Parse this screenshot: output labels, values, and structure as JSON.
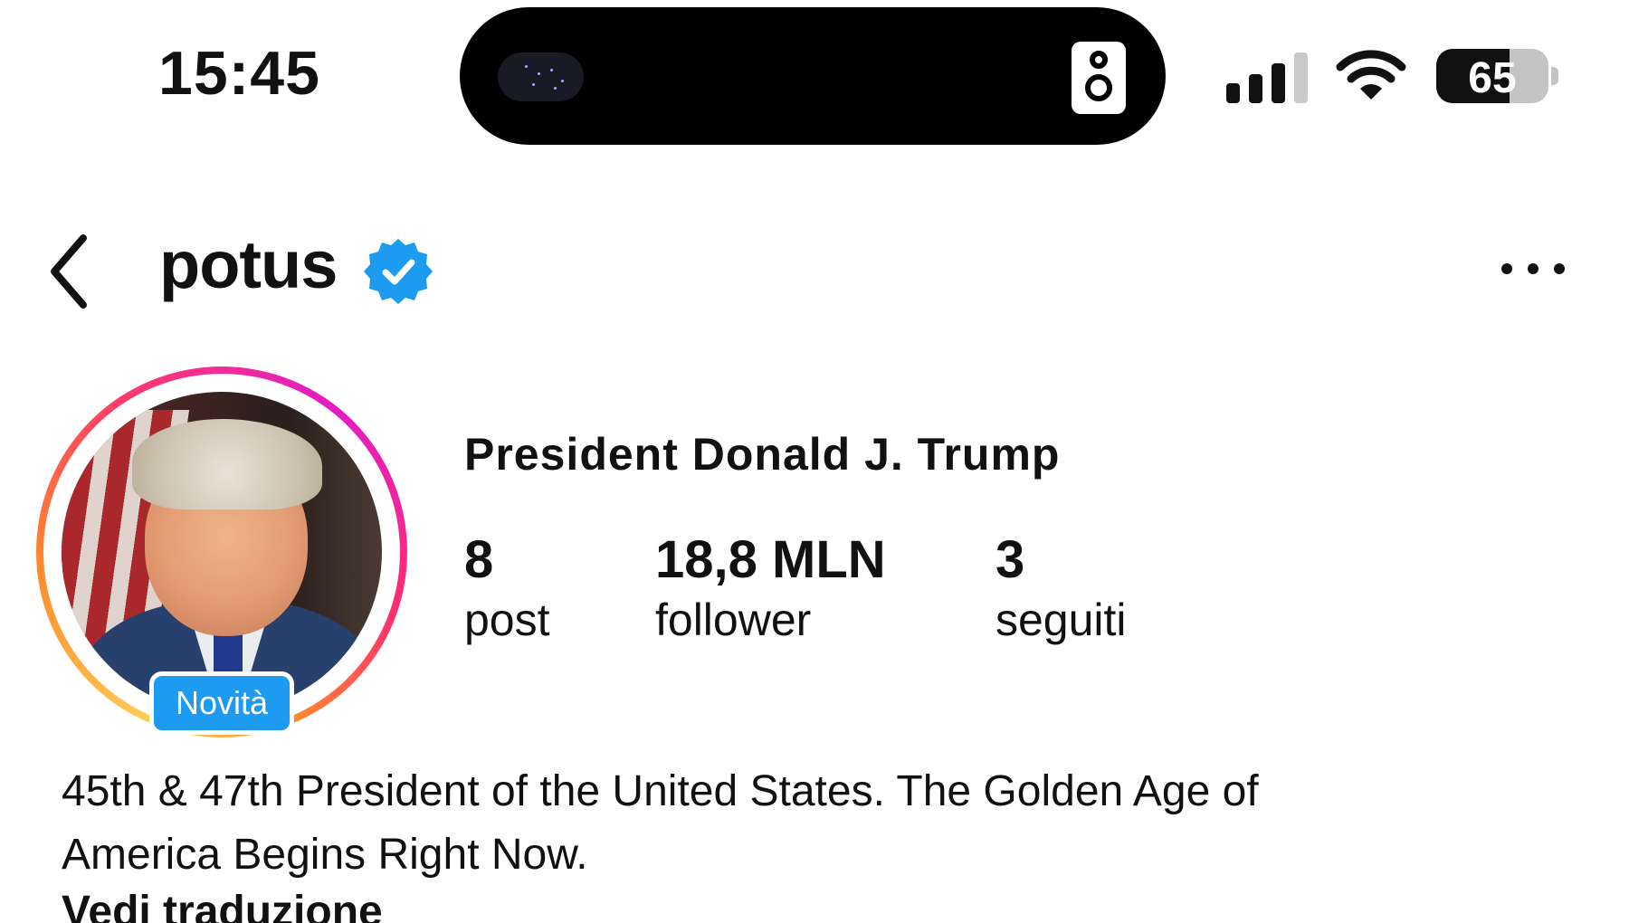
{
  "status_bar": {
    "time": "15:45",
    "battery_percent": "65",
    "battery_level": 0.65,
    "signal_bars_active": 3,
    "signal_bars_total": 4
  },
  "header": {
    "username": "potus",
    "verified": true,
    "back_icon": "chevron-left-icon",
    "more_icon": "more-horizontal-icon",
    "verified_color": "#1D9BF0"
  },
  "profile": {
    "display_name": "President Donald J. Trump",
    "story_badge": "Novità",
    "stats": [
      {
        "value": "8",
        "label": "post"
      },
      {
        "value": "18,8 MLN",
        "label": "follower"
      },
      {
        "value": "3",
        "label": "seguiti"
      }
    ],
    "bio_line1": "45th & 47th President of the United States. The Golden Age of",
    "bio_line2": "America Begins Right Now.",
    "translate_link": "Vedi traduzione"
  }
}
